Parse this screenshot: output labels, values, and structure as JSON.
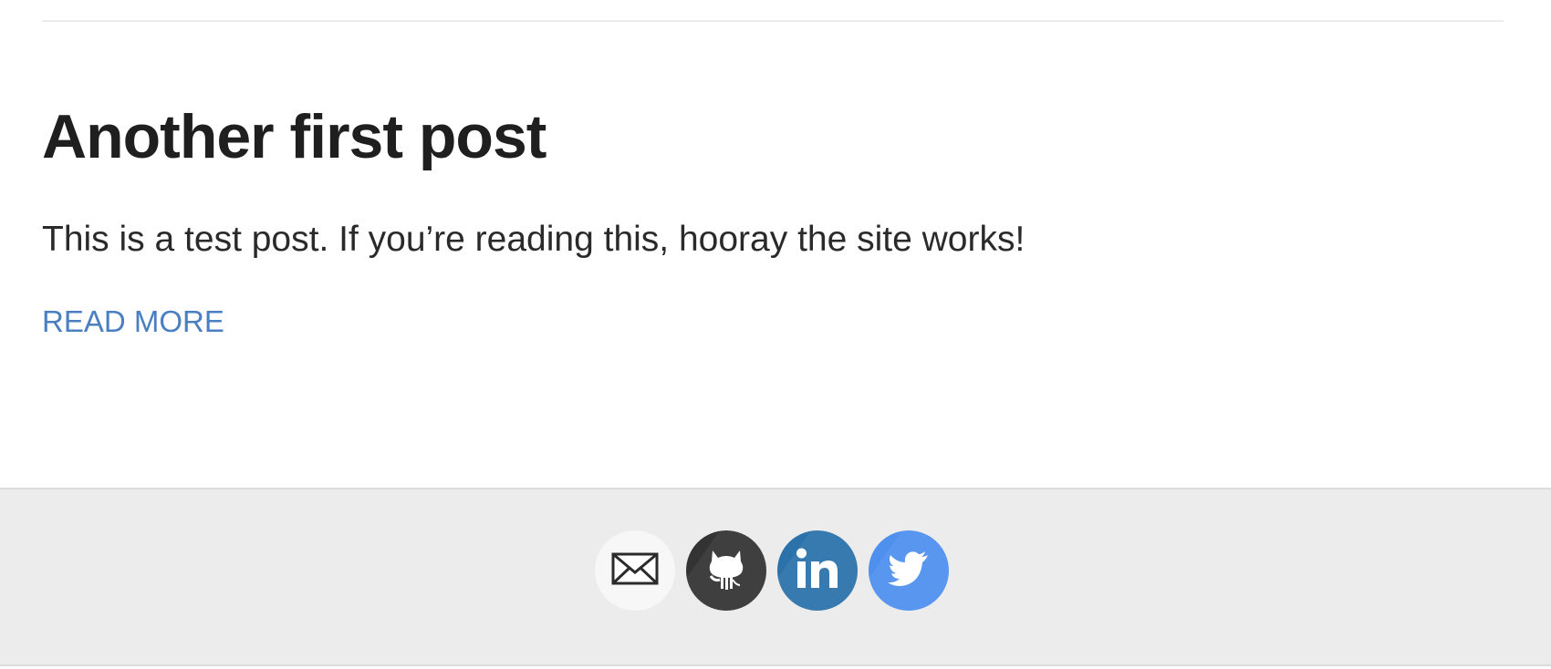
{
  "post": {
    "title": "Another first post",
    "excerpt": "This is a test post. If you’re reading this, hooray the site works!",
    "read_more_label": "READ MORE"
  },
  "footer": {
    "social_links": [
      {
        "name": "email",
        "icon": "envelope-icon",
        "color": "#f7f7f7"
      },
      {
        "name": "github",
        "icon": "github-octocat-icon",
        "color": "#333333"
      },
      {
        "name": "linkedin",
        "icon": "linkedin-icon",
        "color": "#2b72ab"
      },
      {
        "name": "twitter",
        "icon": "twitter-bird-icon",
        "color": "#4f90ee"
      }
    ]
  },
  "colors": {
    "link": "#4a7fc1",
    "footer_bg": "#ececec",
    "title_text": "#1f1f1f"
  }
}
